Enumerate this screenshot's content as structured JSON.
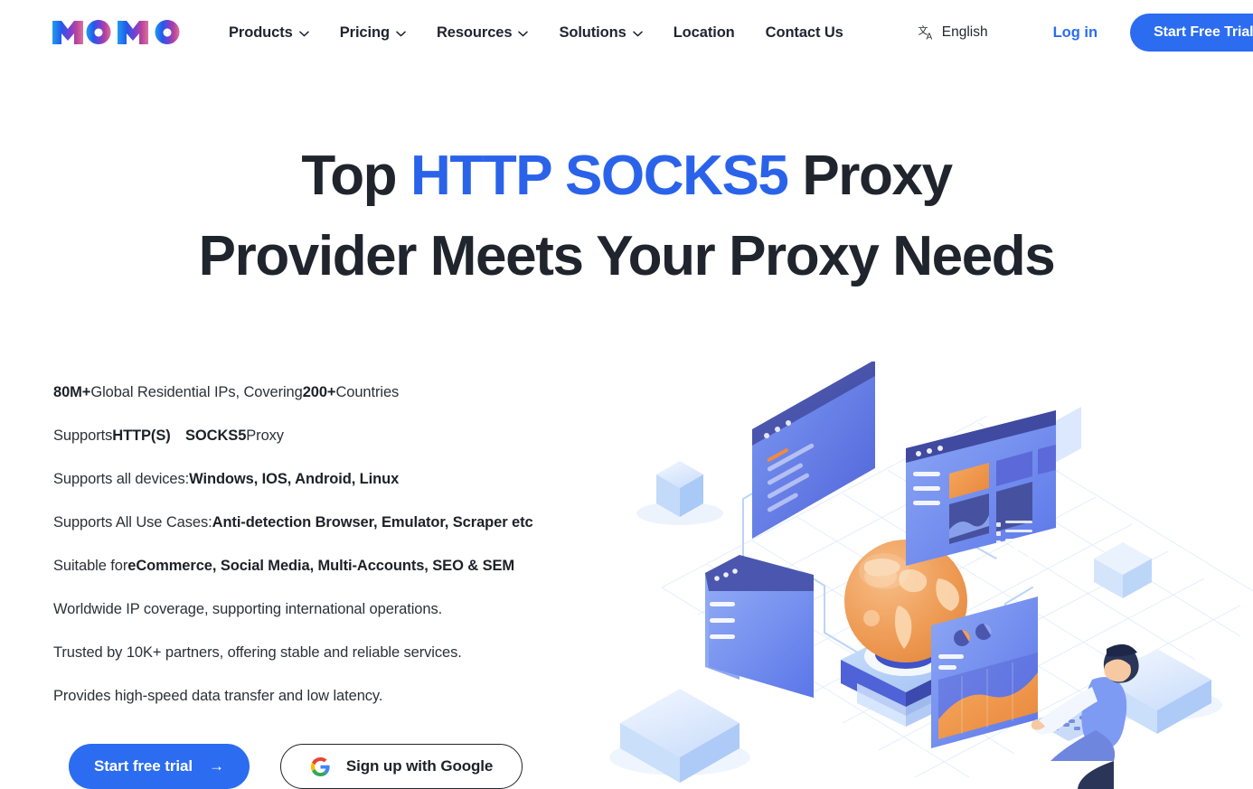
{
  "brand": {
    "logo_text": "MOMO",
    "logo_gradient_from": "#1f9cf0",
    "logo_gradient_mid": "#2b5fe8",
    "logo_gradient_to": "#d4669e",
    "accent_blue": "#2b6cf0",
    "headline_blue": "#2a63ea",
    "text_dark": "#20242c"
  },
  "header": {
    "nav": [
      {
        "label": "Products",
        "has_dropdown": true,
        "icon": "chevron-down-icon"
      },
      {
        "label": "Pricing",
        "has_dropdown": true,
        "icon": "chevron-down-icon"
      },
      {
        "label": "Resources",
        "has_dropdown": true,
        "icon": "chevron-down-icon"
      },
      {
        "label": "Solutions",
        "has_dropdown": true,
        "icon": "chevron-down-icon"
      },
      {
        "label": "Location",
        "has_dropdown": false,
        "icon": ""
      },
      {
        "label": "Contact Us",
        "has_dropdown": false,
        "icon": ""
      }
    ],
    "language": {
      "label": "English",
      "icon": "translate-icon"
    },
    "login_label": "Log in",
    "trial_button_label": "Start Free Trial"
  },
  "hero": {
    "headline": {
      "line1_pre": "Top ",
      "line1_accent": "HTTP SOCKS5",
      "line1_post": " Proxy",
      "line2": "Provider Meets Your Proxy Needs"
    },
    "features": [
      {
        "pre": "",
        "bold1": "80M+",
        "mid": " Global Residential IPs, Covering ",
        "bold2": "200+",
        "post": " Countries"
      },
      {
        "pre": "Supports ",
        "bold1": "HTTP(S) SOCKS5",
        "mid": "",
        "bold2": "",
        "post": " Proxy"
      },
      {
        "pre": "Supports all devices: ",
        "bold1": "Windows, IOS, Android, Linux",
        "mid": "",
        "bold2": "",
        "post": ""
      },
      {
        "pre": "Supports All Use Cases: ",
        "bold1": "Anti-detection Browser, Emulator, Scraper etc",
        "mid": "",
        "bold2": "",
        "post": ""
      },
      {
        "pre": "Suitable for ",
        "bold1": "eCommerce, Social Media, Multi-Accounts, SEO & SEM",
        "mid": "",
        "bold2": "",
        "post": ""
      },
      {
        "pre": "Worldwide IP coverage, supporting international operations.",
        "bold1": "",
        "mid": "",
        "bold2": "",
        "post": ""
      },
      {
        "pre": "Trusted by 10K+ partners, offering stable and reliable services.",
        "bold1": "",
        "mid": "",
        "bold2": "",
        "post": ""
      },
      {
        "pre": "Provides high-speed data transfer and low latency.",
        "bold1": "",
        "mid": "",
        "bold2": "",
        "post": ""
      }
    ],
    "cta": {
      "primary_label": "Start free trial",
      "primary_arrow": "→",
      "google_label": "Sign up with Google",
      "google_icon": "google-g-icon"
    },
    "illustration": {
      "name": "isometric-global-proxy-network-illustration",
      "elements": [
        "browser-window-back",
        "browser-window-left",
        "dashboard-panel-top-right",
        "dashboard-panel-bottom-right",
        "globe-on-pedestal",
        "person-at-keyboard",
        "isometric-cube-left",
        "isometric-cube-bottom-left",
        "isometric-cube-right",
        "isometric-cube-bottom-right",
        "grid-floor",
        "connection-lines"
      ],
      "globe_color": "#f0a05a",
      "panel_blue": "#6a8bf0",
      "panel_dark": "#4a58b5"
    }
  }
}
